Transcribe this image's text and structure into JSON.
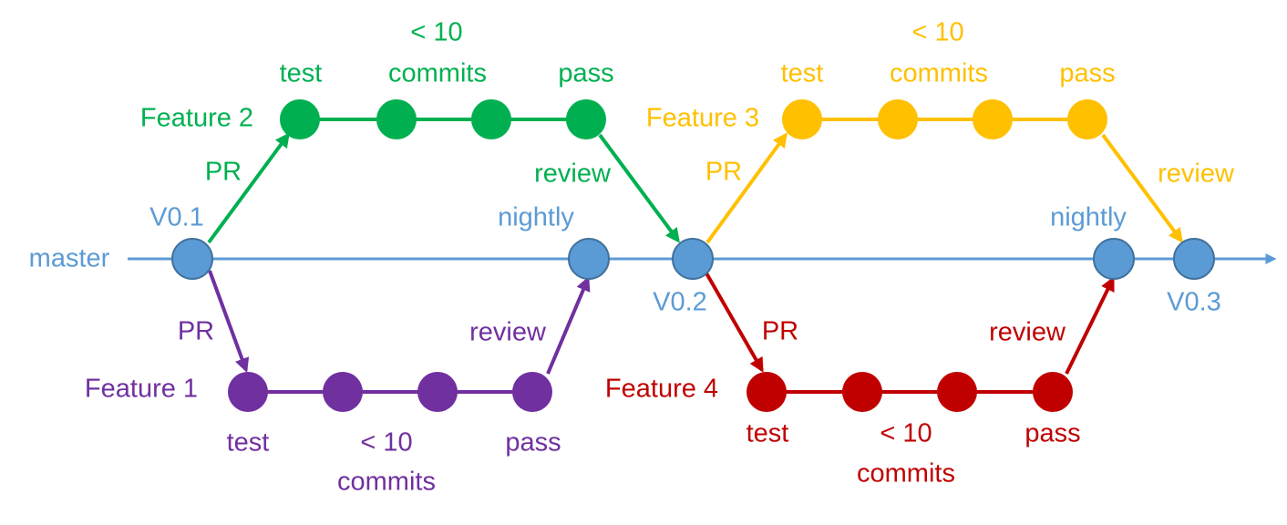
{
  "colors": {
    "master": "#5B9BD5",
    "master_stroke": "#41719C",
    "feature1": "#7030A0",
    "feature2": "#00B050",
    "feature3": "#FFC000",
    "feature4": "#C00000"
  },
  "master": {
    "label": "master",
    "v01": "V0.1",
    "v02": "V0.2",
    "v03": "V0.3",
    "nightly1": "nightly",
    "nightly2": "nightly"
  },
  "feature1": {
    "name": "Feature 1",
    "pr": "PR",
    "test": "test",
    "commits_top": "< 10",
    "commits_bottom": "commits",
    "pass": "pass",
    "review": "review"
  },
  "feature2": {
    "name": "Feature 2",
    "pr": "PR",
    "test": "test",
    "commits_top": "< 10",
    "commits_bottom": "commits",
    "pass": "pass",
    "review": "review"
  },
  "feature3": {
    "name": "Feature 3",
    "pr": "PR",
    "test": "test",
    "commits_top": "< 10",
    "commits_bottom": "commits",
    "pass": "pass",
    "review": "review"
  },
  "feature4": {
    "name": "Feature 4",
    "pr": "PR",
    "test": "test",
    "commits_top": "< 10",
    "commits_bottom": "commits",
    "pass": "pass",
    "review": "review"
  }
}
